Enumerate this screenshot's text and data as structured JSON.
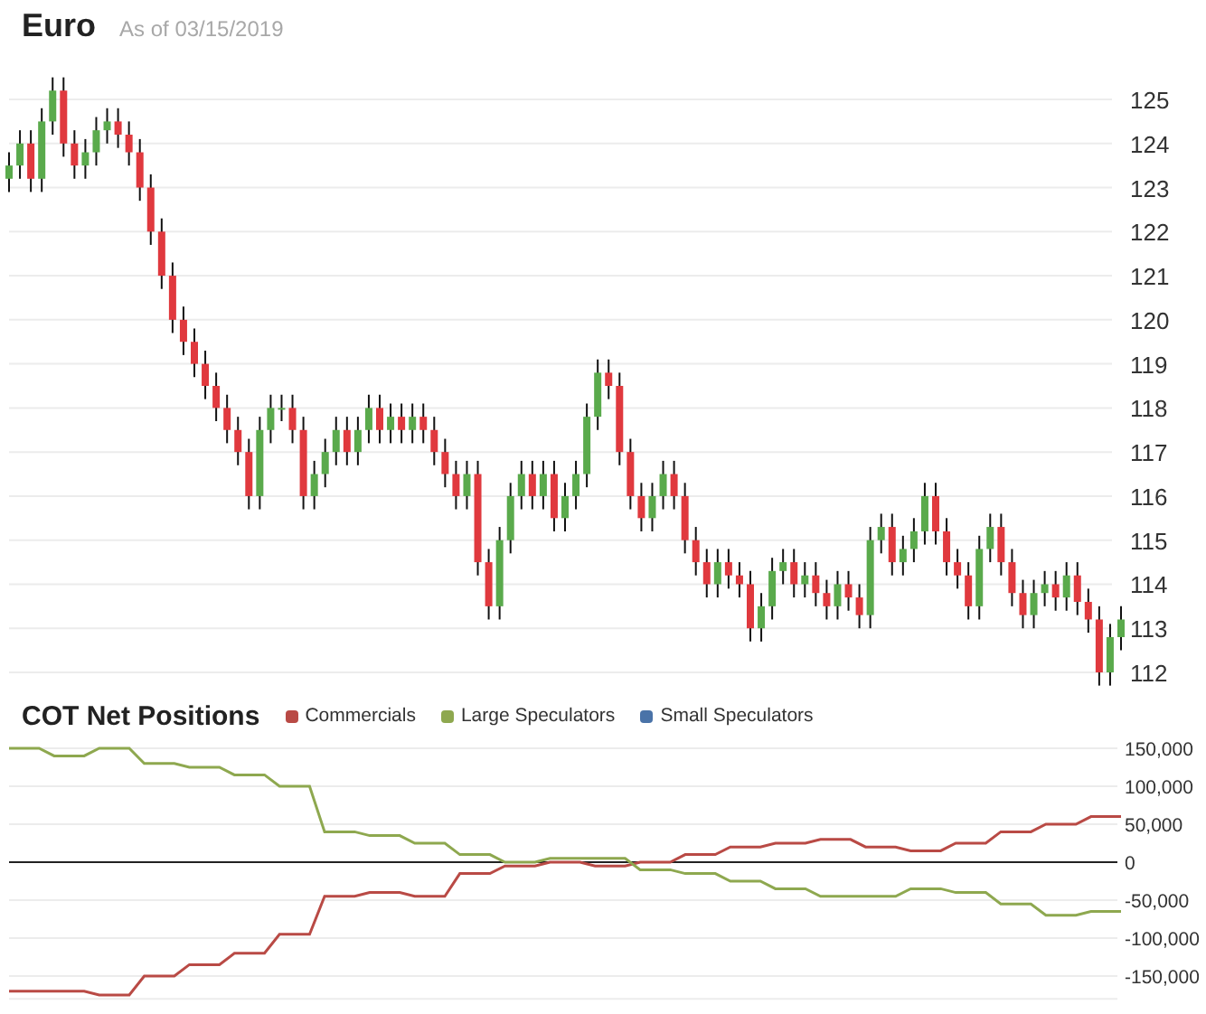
{
  "header": {
    "title": "Euro",
    "subtitle": "As of 03/15/2019"
  },
  "price_chart": {
    "chart_data": {
      "type": "candlestick",
      "grid": true,
      "ylim": [
        112,
        125
      ],
      "yticks": [
        112,
        113,
        114,
        115,
        116,
        117,
        118,
        119,
        120,
        121,
        122,
        123,
        124,
        125
      ],
      "ohlc": [
        [
          123.2,
          123.8,
          122.9,
          123.5
        ],
        [
          123.5,
          124.3,
          123.2,
          124
        ],
        [
          124,
          124.3,
          122.9,
          123.2
        ],
        [
          123.2,
          124.8,
          122.9,
          124.5
        ],
        [
          124.5,
          125.5,
          124.2,
          125.2
        ],
        [
          125.2,
          125.5,
          123.7,
          124
        ],
        [
          124,
          124.3,
          123.2,
          123.5
        ],
        [
          123.5,
          124.1,
          123.2,
          123.8
        ],
        [
          123.8,
          124.6,
          123.5,
          124.3
        ],
        [
          124.3,
          124.8,
          124,
          124.5
        ],
        [
          124.5,
          124.8,
          123.9,
          124.2
        ],
        [
          124.2,
          124.5,
          123.5,
          123.8
        ],
        [
          123.8,
          124.1,
          122.7,
          123
        ],
        [
          123,
          123.3,
          121.7,
          122
        ],
        [
          122,
          122.3,
          120.7,
          121
        ],
        [
          121,
          121.3,
          119.7,
          120
        ],
        [
          120,
          120.3,
          119.2,
          119.5
        ],
        [
          119.5,
          119.8,
          118.7,
          119
        ],
        [
          119,
          119.3,
          118.2,
          118.5
        ],
        [
          118.5,
          118.8,
          117.7,
          118
        ],
        [
          118,
          118.3,
          117.2,
          117.5
        ],
        [
          117.5,
          117.8,
          116.7,
          117
        ],
        [
          117,
          117.3,
          115.7,
          116
        ],
        [
          116,
          117.8,
          115.7,
          117.5
        ],
        [
          117.5,
          118.3,
          117.2,
          118
        ],
        [
          118,
          118.3,
          117.7,
          118
        ],
        [
          118,
          118.3,
          117.2,
          117.5
        ],
        [
          117.5,
          117.8,
          115.7,
          116
        ],
        [
          116,
          116.8,
          115.7,
          116.5
        ],
        [
          116.5,
          117.3,
          116.2,
          117
        ],
        [
          117,
          117.8,
          116.7,
          117.5
        ],
        [
          117.5,
          117.8,
          116.7,
          117
        ],
        [
          117,
          117.8,
          116.7,
          117.5
        ],
        [
          117.5,
          118.3,
          117.2,
          118
        ],
        [
          118,
          118.3,
          117.2,
          117.5
        ],
        [
          117.5,
          118.1,
          117.2,
          117.8
        ],
        [
          117.8,
          118.1,
          117.2,
          117.5
        ],
        [
          117.5,
          118.1,
          117.2,
          117.8
        ],
        [
          117.8,
          118.1,
          117.2,
          117.5
        ],
        [
          117.5,
          117.8,
          116.7,
          117
        ],
        [
          117,
          117.3,
          116.2,
          116.5
        ],
        [
          116.5,
          116.8,
          115.7,
          116
        ],
        [
          116,
          116.8,
          115.7,
          116.5
        ],
        [
          116.5,
          116.8,
          114.2,
          114.5
        ],
        [
          114.5,
          114.8,
          113.2,
          113.5
        ],
        [
          113.5,
          115.3,
          113.2,
          115
        ],
        [
          115,
          116.3,
          114.7,
          116
        ],
        [
          116,
          116.8,
          115.7,
          116.5
        ],
        [
          116.5,
          116.8,
          115.7,
          116
        ],
        [
          116,
          116.8,
          115.7,
          116.5
        ],
        [
          116.5,
          116.8,
          115.2,
          115.5
        ],
        [
          115.5,
          116.3,
          115.2,
          116
        ],
        [
          116,
          116.8,
          115.7,
          116.5
        ],
        [
          116.5,
          118.1,
          116.2,
          117.8
        ],
        [
          117.8,
          119.1,
          117.5,
          118.8
        ],
        [
          118.8,
          119.1,
          118.2,
          118.5
        ],
        [
          118.5,
          118.8,
          116.7,
          117
        ],
        [
          117,
          117.3,
          115.7,
          116
        ],
        [
          116,
          116.3,
          115.2,
          115.5
        ],
        [
          115.5,
          116.3,
          115.2,
          116
        ],
        [
          116,
          116.8,
          115.7,
          116.5
        ],
        [
          116.5,
          116.8,
          115.7,
          116
        ],
        [
          116,
          116.3,
          114.7,
          115
        ],
        [
          115,
          115.3,
          114.2,
          114.5
        ],
        [
          114.5,
          114.8,
          113.7,
          114
        ],
        [
          114,
          114.8,
          113.7,
          114.5
        ],
        [
          114.5,
          114.8,
          113.9,
          114.2
        ],
        [
          114.2,
          114.5,
          113.7,
          114
        ],
        [
          114,
          114.3,
          112.7,
          113
        ],
        [
          113,
          113.8,
          112.7,
          113.5
        ],
        [
          113.5,
          114.6,
          113.2,
          114.3
        ],
        [
          114.3,
          114.8,
          114,
          114.5
        ],
        [
          114.5,
          114.8,
          113.7,
          114
        ],
        [
          114,
          114.5,
          113.7,
          114.2
        ],
        [
          114.2,
          114.5,
          113.5,
          113.8
        ],
        [
          113.8,
          114.1,
          113.2,
          113.5
        ],
        [
          113.5,
          114.3,
          113.2,
          114
        ],
        [
          114,
          114.3,
          113.4,
          113.7
        ],
        [
          113.7,
          114,
          113,
          113.3
        ],
        [
          113.3,
          115.3,
          113,
          115
        ],
        [
          115,
          115.6,
          114.7,
          115.3
        ],
        [
          115.3,
          115.6,
          114.2,
          114.5
        ],
        [
          114.5,
          115.1,
          114.2,
          114.8
        ],
        [
          114.8,
          115.5,
          114.5,
          115.2
        ],
        [
          115.2,
          116.3,
          114.9,
          116
        ],
        [
          116,
          116.3,
          114.9,
          115.2
        ],
        [
          115.2,
          115.5,
          114.2,
          114.5
        ],
        [
          114.5,
          114.8,
          113.9,
          114.2
        ],
        [
          114.2,
          114.5,
          113.2,
          113.5
        ],
        [
          113.5,
          115.1,
          113.2,
          114.8
        ],
        [
          114.8,
          115.6,
          114.5,
          115.3
        ],
        [
          115.3,
          115.6,
          114.2,
          114.5
        ],
        [
          114.5,
          114.8,
          113.5,
          113.8
        ],
        [
          113.8,
          114.1,
          113,
          113.3
        ],
        [
          113.3,
          114.1,
          113,
          113.8
        ],
        [
          113.8,
          114.3,
          113.5,
          114
        ],
        [
          114,
          114.3,
          113.4,
          113.7
        ],
        [
          113.7,
          114.5,
          113.4,
          114.2
        ],
        [
          114.2,
          114.5,
          113.3,
          113.6
        ],
        [
          113.6,
          113.9,
          112.9,
          113.2
        ],
        [
          113.2,
          113.5,
          111.7,
          112
        ],
        [
          112,
          113.1,
          111.7,
          112.8
        ],
        [
          112.8,
          113.5,
          112.5,
          113.2
        ]
      ]
    }
  },
  "cot_chart": {
    "chart_data": {
      "type": "line",
      "title": "COT Net Positions",
      "grid": true,
      "ylim": [
        -180000,
        150000
      ],
      "yticks": [
        {
          "value": 150000,
          "label": "150,000"
        },
        {
          "value": 100000,
          "label": "100,000"
        },
        {
          "value": 50000,
          "label": "50,000"
        },
        {
          "value": 0,
          "label": "0"
        },
        {
          "value": -50000,
          "label": "-50,000"
        },
        {
          "value": -100000,
          "label": "-100,000"
        },
        {
          "value": -150000,
          "label": "-150,000"
        }
      ],
      "series": [
        {
          "name": "Commercials",
          "color": "#b94a45",
          "values": [
            -170000,
            -170000,
            -170000,
            -170000,
            -170000,
            -170000,
            -175000,
            -175000,
            -175000,
            -150000,
            -150000,
            -150000,
            -135000,
            -135000,
            -135000,
            -120000,
            -120000,
            -120000,
            -95000,
            -95000,
            -95000,
            -45000,
            -45000,
            -45000,
            -40000,
            -40000,
            -40000,
            -45000,
            -45000,
            -45000,
            -15000,
            -15000,
            -15000,
            -5000,
            -5000,
            -5000,
            0,
            0,
            0,
            -5000,
            -5000,
            -5000,
            0,
            0,
            0,
            10000,
            10000,
            10000,
            20000,
            20000,
            20000,
            25000,
            25000,
            25000,
            30000,
            30000,
            30000,
            20000,
            20000,
            20000,
            15000,
            15000,
            15000,
            25000,
            25000,
            25000,
            40000,
            40000,
            40000,
            50000,
            50000,
            50000,
            60000,
            60000,
            60000
          ]
        },
        {
          "name": "Large Speculators",
          "color": "#8ea84f",
          "values": [
            150000,
            150000,
            150000,
            140000,
            140000,
            140000,
            150000,
            150000,
            150000,
            130000,
            130000,
            130000,
            125000,
            125000,
            125000,
            115000,
            115000,
            115000,
            100000,
            100000,
            100000,
            40000,
            40000,
            40000,
            35000,
            35000,
            35000,
            25000,
            25000,
            25000,
            10000,
            10000,
            10000,
            0,
            0,
            0,
            5000,
            5000,
            5000,
            5000,
            5000,
            5000,
            -10000,
            -10000,
            -10000,
            -15000,
            -15000,
            -15000,
            -25000,
            -25000,
            -25000,
            -35000,
            -35000,
            -35000,
            -45000,
            -45000,
            -45000,
            -45000,
            -45000,
            -45000,
            -35000,
            -35000,
            -35000,
            -40000,
            -40000,
            -40000,
            -55000,
            -55000,
            -55000,
            -70000,
            -70000,
            -70000,
            -65000,
            -65000,
            -65000
          ]
        },
        {
          "name": "Small Speculators",
          "color": "#4a73a8",
          "values": [
            null,
            null,
            null,
            null,
            null,
            null,
            null,
            null,
            null,
            null,
            null,
            null,
            null,
            null,
            null,
            null,
            null,
            null,
            null,
            null,
            null,
            null,
            null,
            null,
            null,
            null,
            null,
            null,
            null,
            null,
            null,
            null,
            null,
            null,
            null,
            null,
            null,
            null,
            null,
            null,
            null,
            null,
            null,
            null,
            null,
            null,
            null,
            null,
            null,
            null,
            null,
            null,
            null,
            null,
            null,
            null,
            null,
            null,
            null,
            null,
            null,
            null,
            null,
            null,
            null,
            null,
            null,
            null,
            null,
            null,
            null,
            null,
            null,
            null,
            null
          ]
        }
      ]
    }
  }
}
